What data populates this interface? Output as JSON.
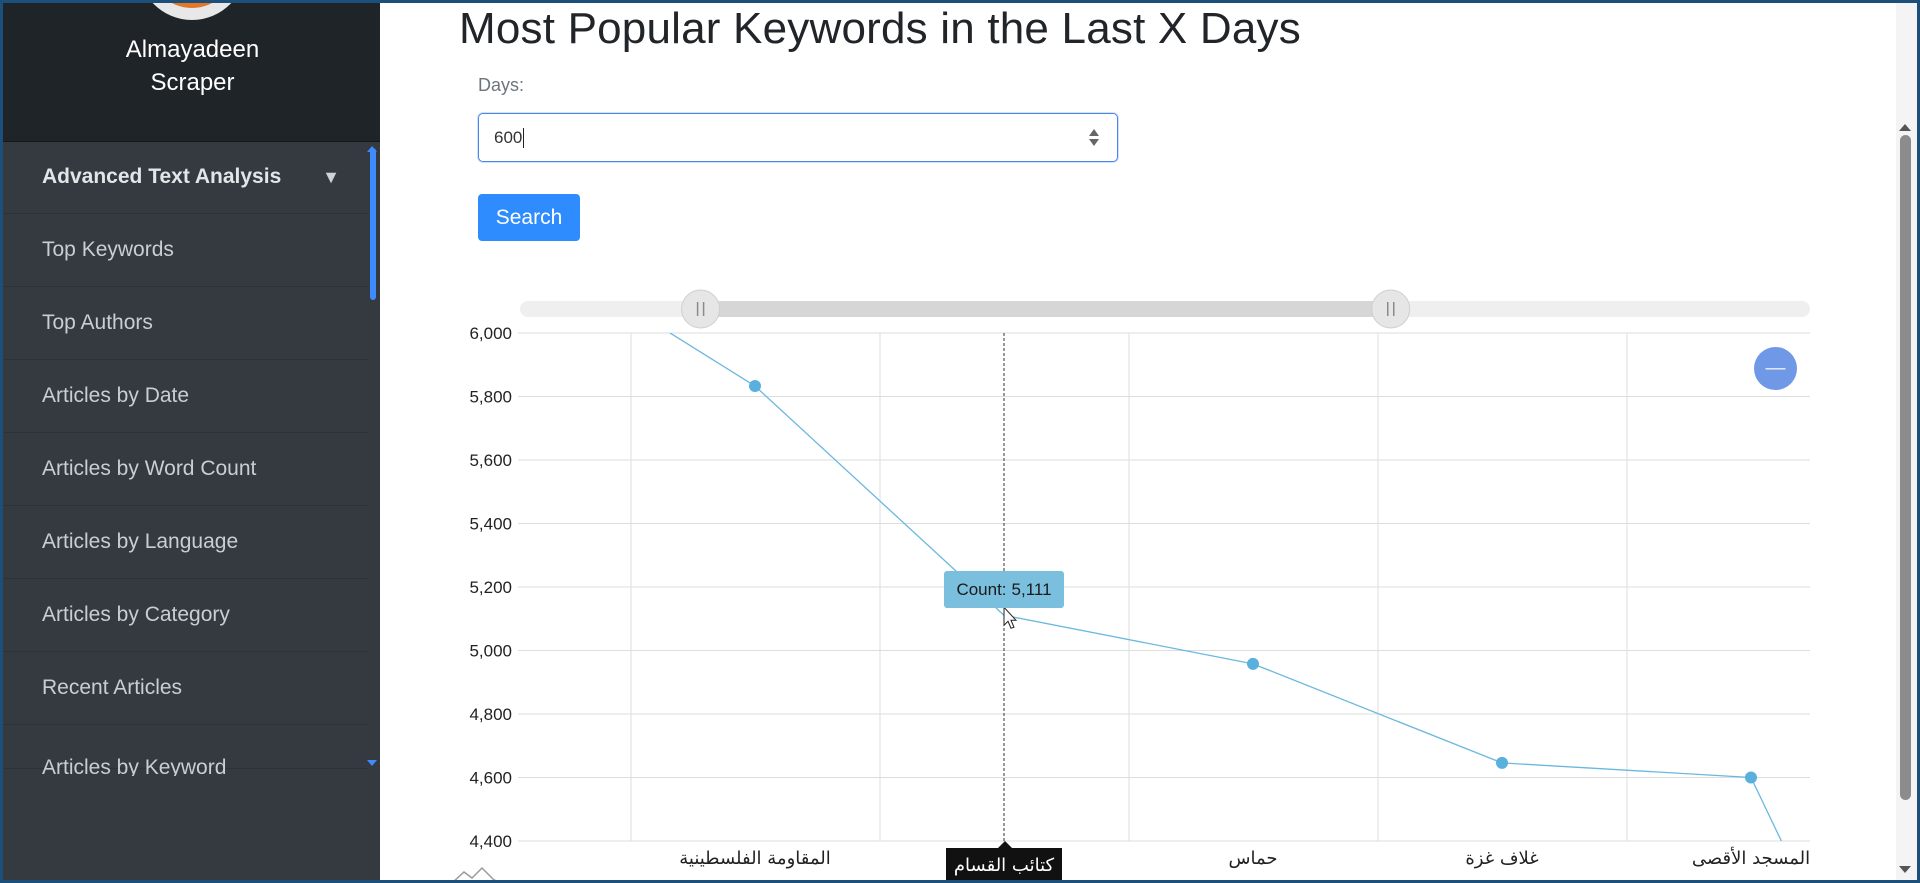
{
  "sidebar": {
    "app_title": "Almayadeen\nScraper",
    "section_header": "Advanced Text Analysis",
    "items": [
      {
        "label": "Top Keywords"
      },
      {
        "label": "Top Authors"
      },
      {
        "label": "Articles by Date"
      },
      {
        "label": "Articles by Word Count"
      },
      {
        "label": "Articles by Language"
      },
      {
        "label": "Articles by Category"
      },
      {
        "label": "Recent Articles"
      },
      {
        "label": "Articles by Keyword"
      }
    ]
  },
  "main": {
    "title": "Most Popular Keywords in the Last X Days",
    "days_label": "Days:",
    "days_value": "600",
    "search_label": "Search"
  },
  "tooltip": {
    "label": "Count:",
    "value": "5,111",
    "category": "كتائب القسام"
  },
  "colors": {
    "line": "#6bb8de",
    "point": "#5ab0dc",
    "accent": "#2f8cff",
    "sidebar": "#343a40"
  },
  "chart_data": {
    "type": "line",
    "ylim": [
      4400,
      6000
    ],
    "yticks": [
      "6,000",
      "5,800",
      "5,600",
      "5,400",
      "5,200",
      "5,000",
      "4,800",
      "4,600",
      "4,400"
    ],
    "categories": [
      "المقاومة الفلسطينية",
      "كتائب القسام",
      "حماس",
      "غلاف غزة",
      "المسجد الأقصى"
    ],
    "series": [
      {
        "values": [
          5833,
          5111,
          4958,
          4646,
          4600
        ]
      }
    ],
    "grid": true,
    "range_slider": {
      "start": 0.14,
      "end": 0.675
    }
  }
}
